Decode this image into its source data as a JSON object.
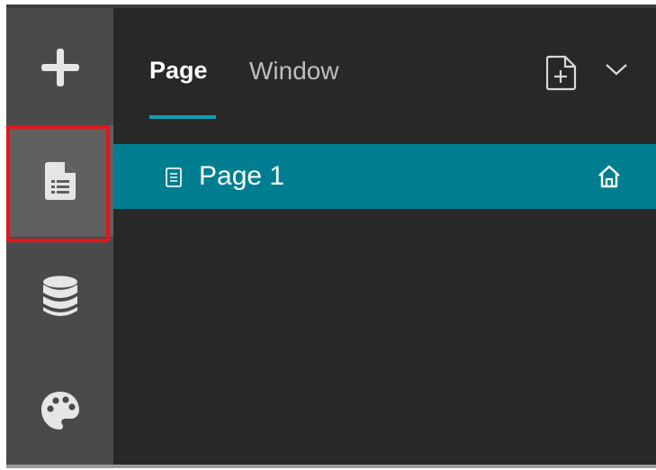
{
  "sidebar": {
    "items": [
      {
        "name": "add",
        "icon": "plus-icon"
      },
      {
        "name": "page",
        "icon": "page-list-icon",
        "active": true
      },
      {
        "name": "data",
        "icon": "database-icon"
      },
      {
        "name": "theme",
        "icon": "palette-icon"
      }
    ]
  },
  "panel": {
    "tabs": [
      {
        "label": "Page",
        "active": true
      },
      {
        "label": "Window",
        "active": false
      }
    ],
    "toolbar": {
      "add_page_icon": "new-page-icon",
      "dropdown_icon": "chevron-down-icon"
    },
    "pages": [
      {
        "label": "Page 1",
        "selected": true,
        "is_home": true
      }
    ]
  },
  "colors": {
    "accent": "#0fa0b2",
    "selected_row": "#007e91",
    "highlight": "#e8141b",
    "rail": "#4a4a4a",
    "panel": "#282828"
  }
}
